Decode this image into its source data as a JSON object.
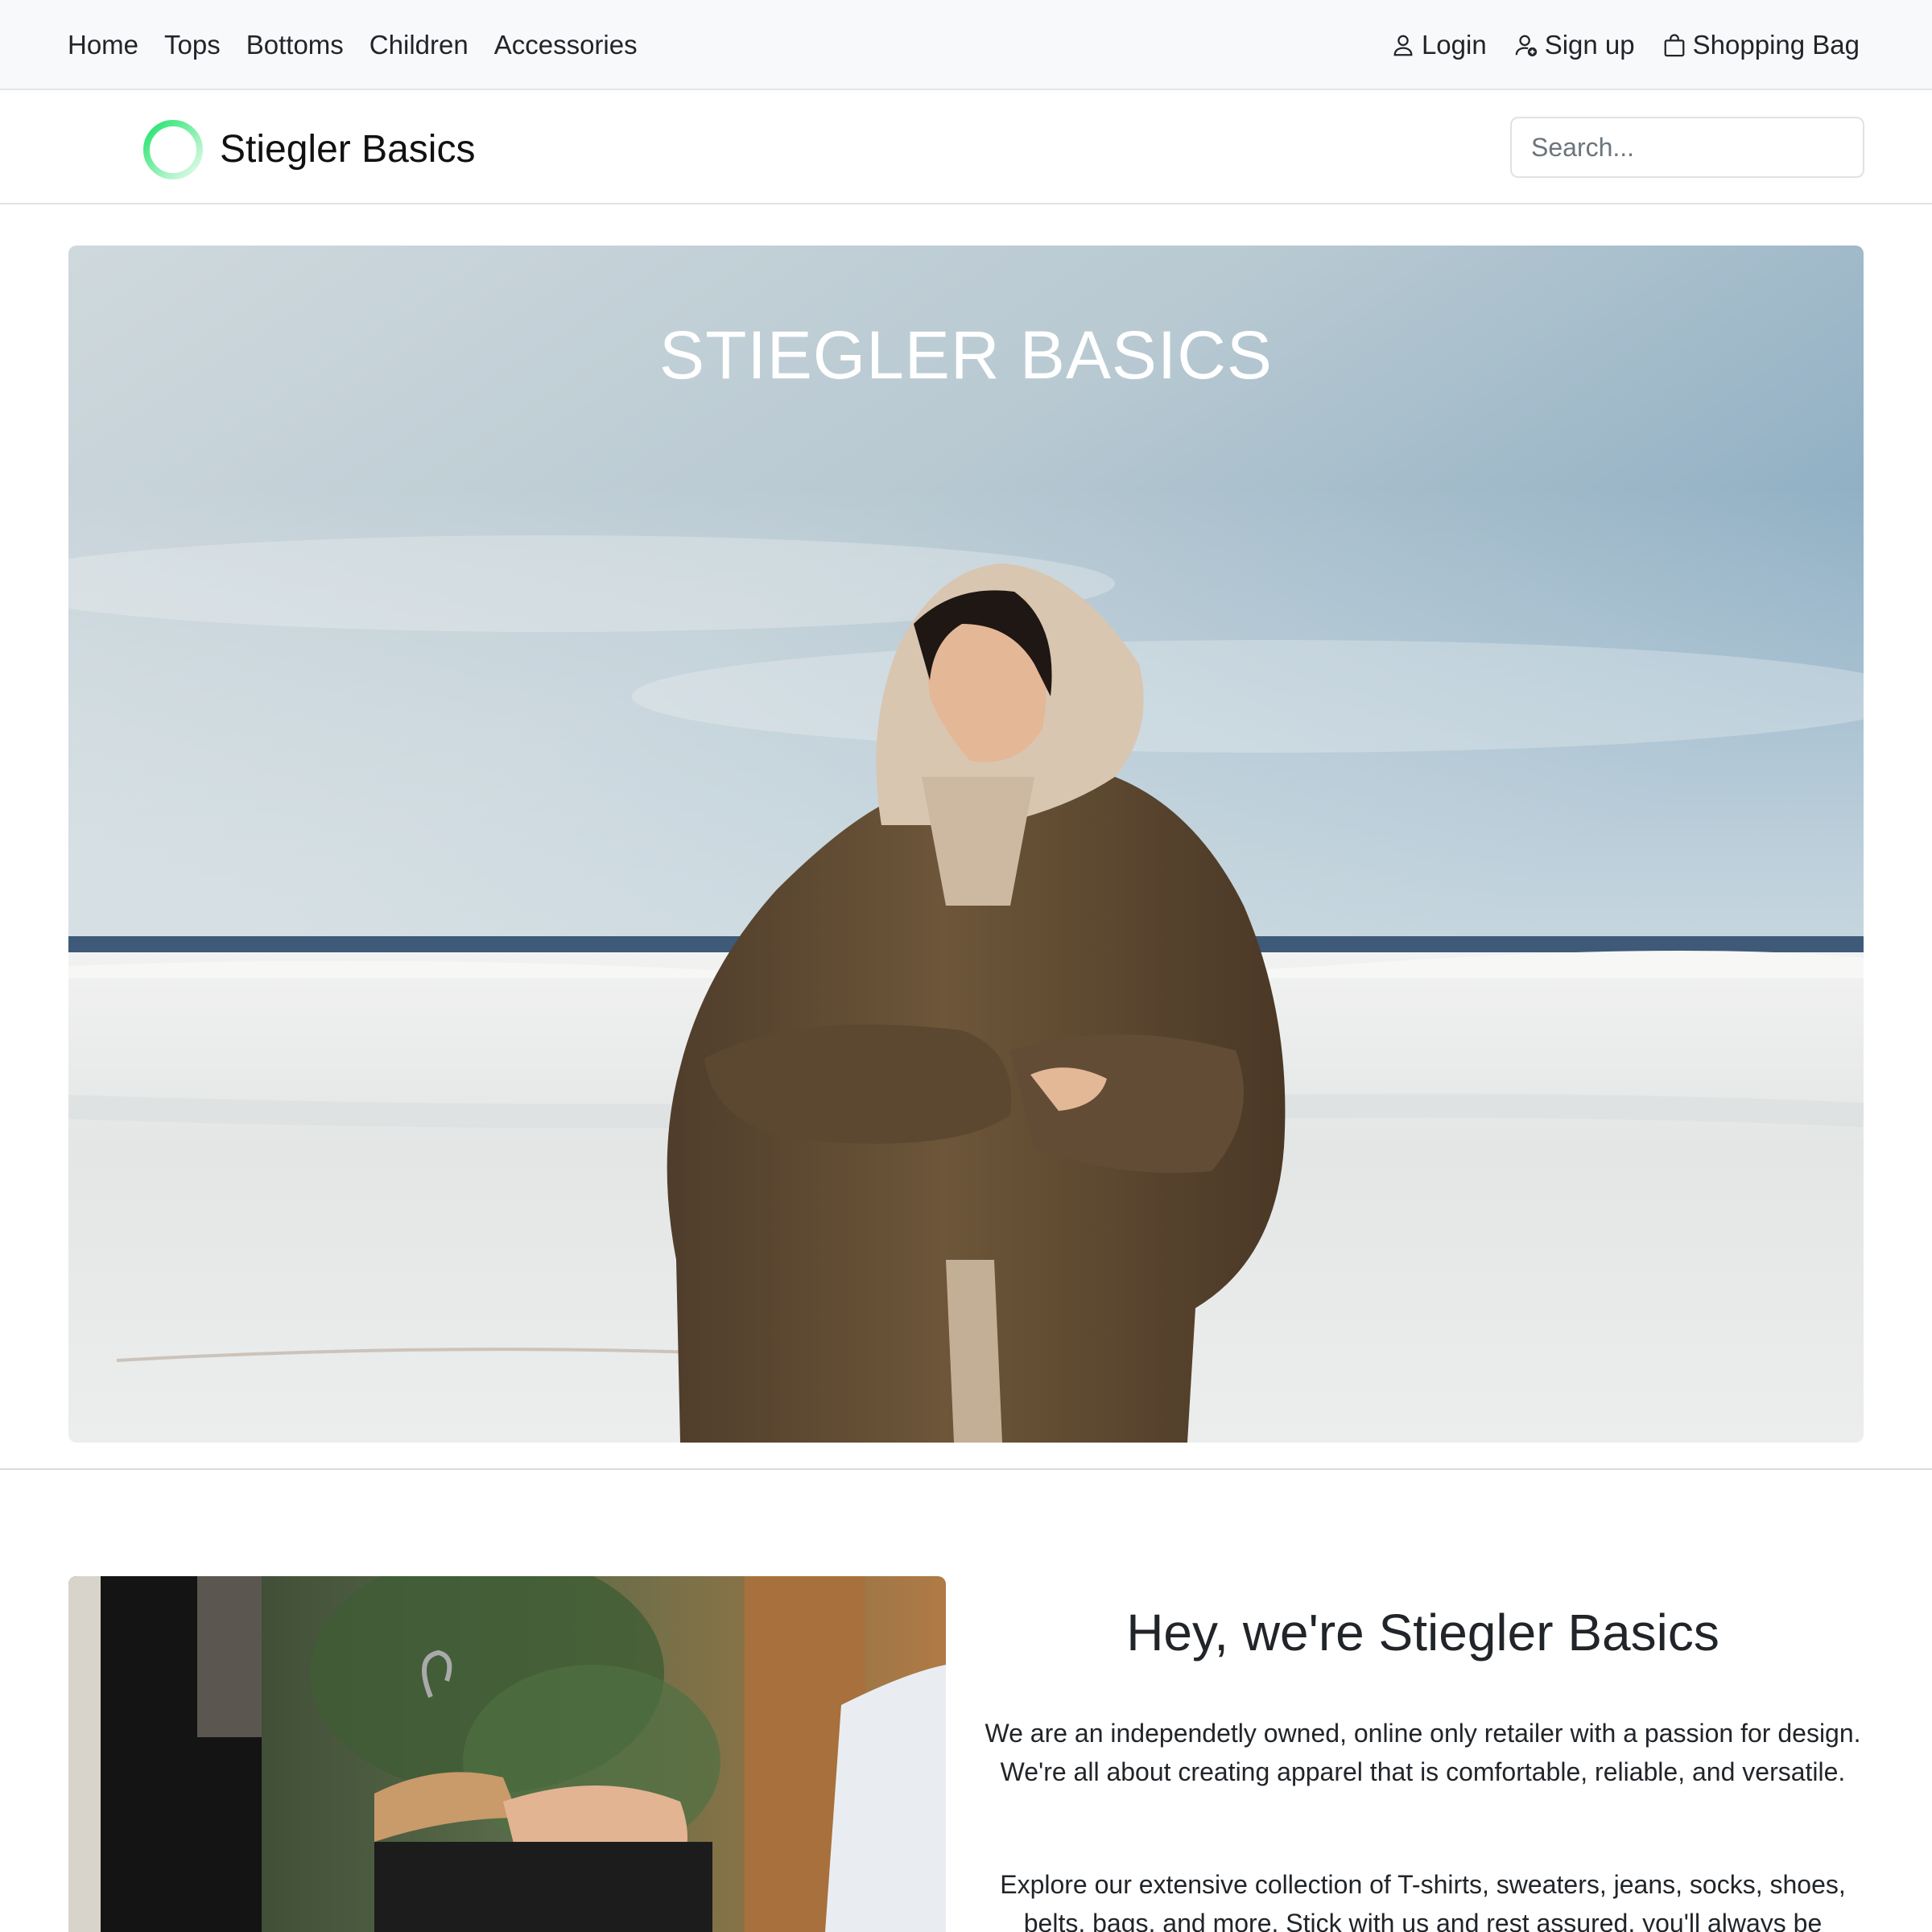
{
  "topnav": {
    "links": [
      "Home",
      "Tops",
      "Bottoms",
      "Children",
      "Accessories"
    ],
    "login": "Login",
    "signup": "Sign up",
    "bag": "Shopping Bag"
  },
  "brand": {
    "name": "Stiegler Basics",
    "logo_colors": [
      "#1fe36a",
      "#e9fbee"
    ],
    "search_placeholder": "Search..."
  },
  "hero": {
    "title": "STIEGLER BASICS"
  },
  "about": {
    "heading": "Hey, we're Stiegler Basics",
    "paragraph1": "We are an independetly owned, online only retailer with a passion for design. We're all about creating apparel that is comfortable, reliable, and versatile.",
    "paragraph2": "Explore our extensive collection of T-shirts, sweaters, jeans, socks, shoes, belts, bags, and more. Stick with us and rest assured, you'll always be"
  }
}
